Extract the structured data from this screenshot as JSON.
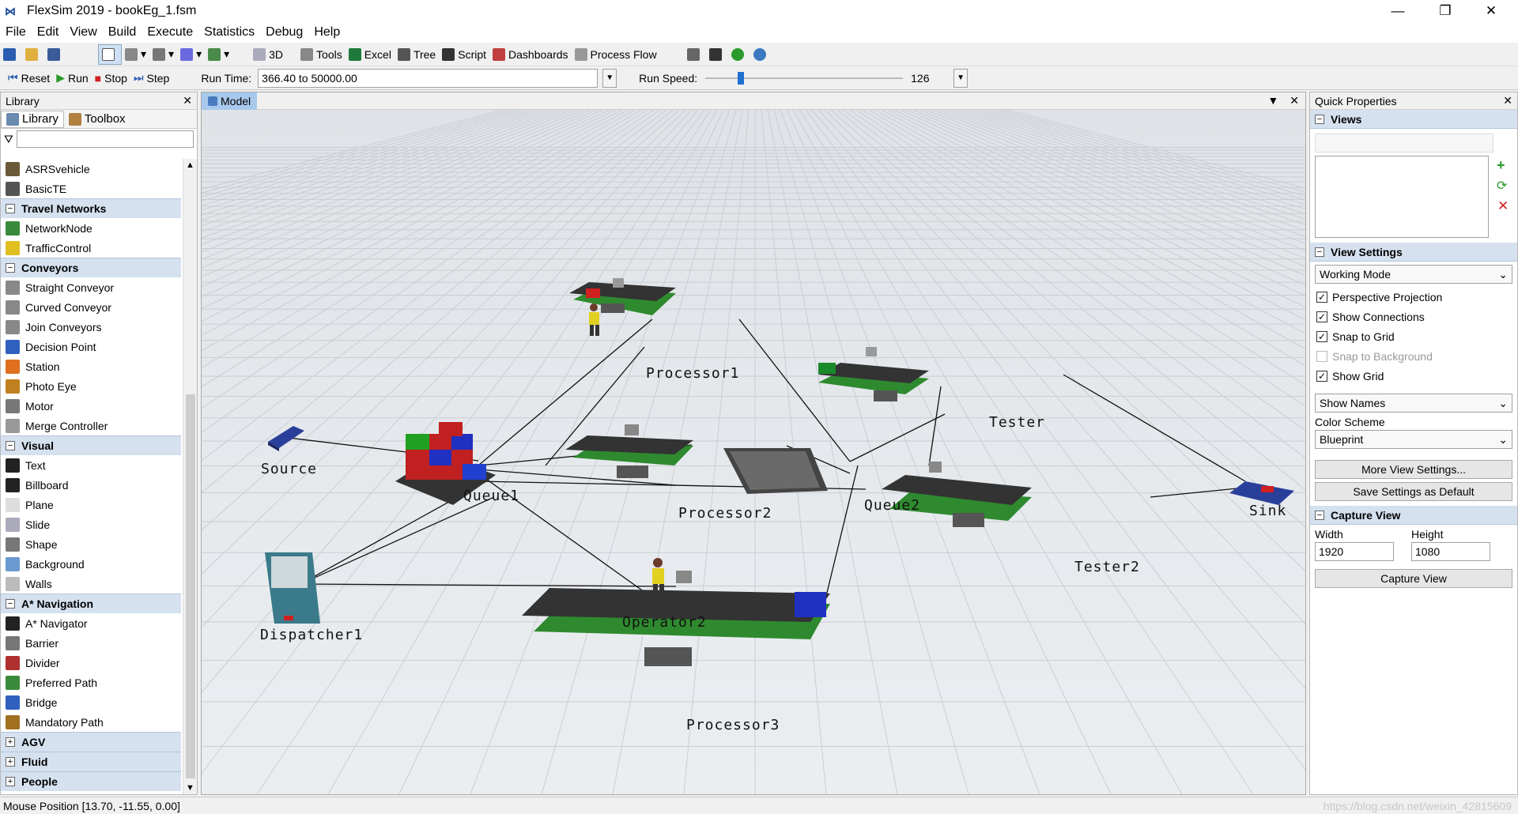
{
  "window": {
    "title": "FlexSim 2019 - bookEg_1.fsm",
    "minimize": "—",
    "restore": "❐",
    "close": "✕"
  },
  "menu": [
    "File",
    "Edit",
    "View",
    "Build",
    "Execute",
    "Statistics",
    "Debug",
    "Help"
  ],
  "toolbar": {
    "view3d": "3D",
    "tools": "Tools",
    "excel": "Excel",
    "tree": "Tree",
    "script": "Script",
    "dashboards": "Dashboards",
    "process_flow": "Process Flow"
  },
  "runbar": {
    "reset": "Reset",
    "run": "Run",
    "stop": "Stop",
    "step": "Step",
    "run_time_label": "Run Time:",
    "run_time_value": "366.40  to  50000.00",
    "run_speed_label": "Run Speed:",
    "run_speed_value": "126",
    "run_speed_fraction": 0.17
  },
  "library": {
    "header": "Library",
    "tab_library": "Library",
    "tab_toolbox": "Toolbox",
    "filter_value": "",
    "items": [
      {
        "type": "item",
        "label": "ASRSvehicle",
        "color": "#6b5a3a"
      },
      {
        "type": "item",
        "label": "BasicTE",
        "color": "#555"
      },
      {
        "type": "cat",
        "label": "Travel Networks"
      },
      {
        "type": "item",
        "label": "NetworkNode",
        "color": "#3a8a3a"
      },
      {
        "type": "item",
        "label": "TrafficControl",
        "color": "#e0c020"
      },
      {
        "type": "cat",
        "label": "Conveyors"
      },
      {
        "type": "item",
        "label": "Straight Conveyor",
        "color": "#888"
      },
      {
        "type": "item",
        "label": "Curved Conveyor",
        "color": "#888"
      },
      {
        "type": "item",
        "label": "Join Conveyors",
        "color": "#888"
      },
      {
        "type": "item",
        "label": "Decision Point",
        "color": "#3060c0"
      },
      {
        "type": "item",
        "label": "Station",
        "color": "#e07020"
      },
      {
        "type": "item",
        "label": "Photo Eye",
        "color": "#c08020"
      },
      {
        "type": "item",
        "label": "Motor",
        "color": "#777"
      },
      {
        "type": "item",
        "label": "Merge Controller",
        "color": "#999"
      },
      {
        "type": "cat",
        "label": "Visual"
      },
      {
        "type": "item",
        "label": "Text",
        "color": "#222"
      },
      {
        "type": "item",
        "label": "Billboard",
        "color": "#222"
      },
      {
        "type": "item",
        "label": "Plane",
        "color": "#ddd"
      },
      {
        "type": "item",
        "label": "Slide",
        "color": "#aab"
      },
      {
        "type": "item",
        "label": "Shape",
        "color": "#777"
      },
      {
        "type": "item",
        "label": "Background",
        "color": "#6a9ad0"
      },
      {
        "type": "item",
        "label": "Walls",
        "color": "#bbb"
      },
      {
        "type": "cat",
        "label": "A* Navigation"
      },
      {
        "type": "item",
        "label": "A* Navigator",
        "color": "#222"
      },
      {
        "type": "item",
        "label": "Barrier",
        "color": "#777"
      },
      {
        "type": "item",
        "label": "Divider",
        "color": "#b03030"
      },
      {
        "type": "item",
        "label": "Preferred Path",
        "color": "#3a8a3a"
      },
      {
        "type": "item",
        "label": "Bridge",
        "color": "#3060c0"
      },
      {
        "type": "item",
        "label": "Mandatory Path",
        "color": "#a07020"
      },
      {
        "type": "cat",
        "label": "AGV"
      },
      {
        "type": "cat",
        "label": "Fluid"
      },
      {
        "type": "cat",
        "label": "People"
      }
    ]
  },
  "model": {
    "tab": "Model",
    "labels": [
      "Source",
      "Queue1",
      "Processor1",
      "Processor2",
      "Processor3",
      "Operator2",
      "Dispatcher1",
      "Queue2",
      "Tester",
      "Tester2",
      "Sink"
    ]
  },
  "quick": {
    "header": "Quick Properties",
    "views": "Views",
    "view_settings": "View Settings",
    "working_mode": "Working Mode",
    "checks": [
      {
        "label": "Perspective Projection",
        "checked": true
      },
      {
        "label": "Show Connections",
        "checked": true
      },
      {
        "label": "Snap to Grid",
        "checked": true
      },
      {
        "label": "Snap to Background",
        "checked": false
      },
      {
        "label": "Show Grid",
        "checked": true
      }
    ],
    "show_names": "Show Names",
    "color_scheme_label": "Color Scheme",
    "color_scheme": "Blueprint",
    "more_view_settings": "More View Settings...",
    "save_default": "Save Settings as Default",
    "capture_view": "Capture View",
    "width_label": "Width",
    "height_label": "Height",
    "width": "1920",
    "height": "1080",
    "capture_btn": "Capture View"
  },
  "status": {
    "mouse": "Mouse Position [13.70, -11.55, 0.00]",
    "watermark": "https://blog.csdn.net/weixin_42815609"
  }
}
